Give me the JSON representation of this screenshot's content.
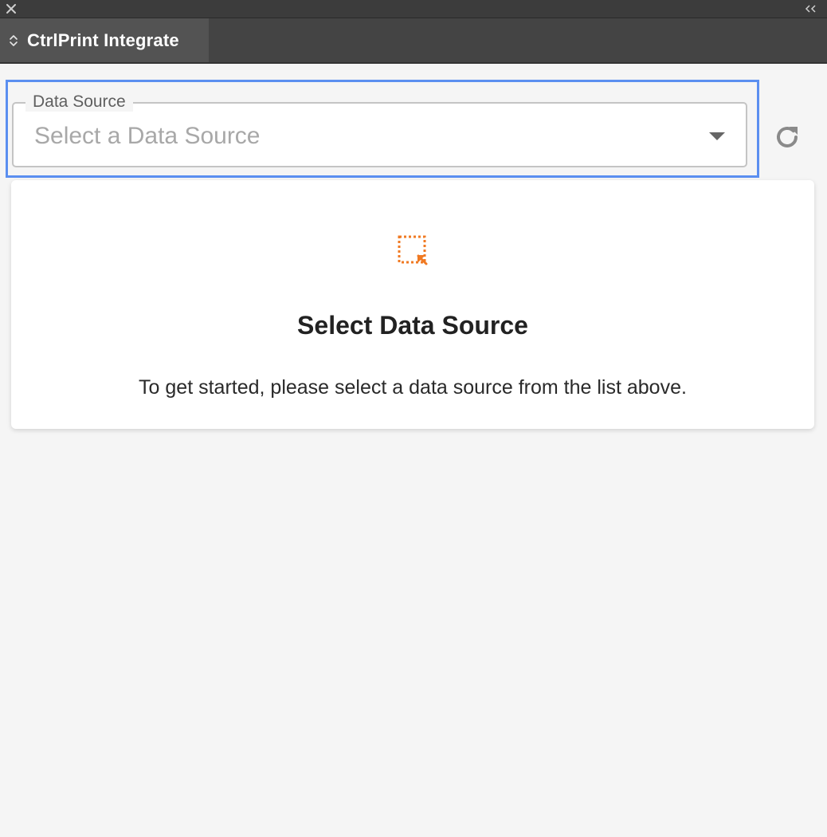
{
  "panel": {
    "tab_title": "CtrlPrint Integrate"
  },
  "icons": {
    "close": "close-icon",
    "collapse": "double-chevron-left-icon",
    "tab": "up-down-chevron-icon",
    "refresh": "refresh-icon",
    "empty_state": "dotted-select-arrow-icon"
  },
  "data_source": {
    "label": "Data Source",
    "placeholder": "Select a Data Source"
  },
  "empty_state": {
    "title": "Select Data Source",
    "message": "To get started, please select a data source from the list above."
  },
  "colors": {
    "focus_ring": "#5b8ff0",
    "accent": "#f07a23",
    "panel_background": "#f5f5f5",
    "tab_background": "#535353",
    "tabbar_background": "#444444",
    "topbar_background": "#3c3c3c"
  }
}
